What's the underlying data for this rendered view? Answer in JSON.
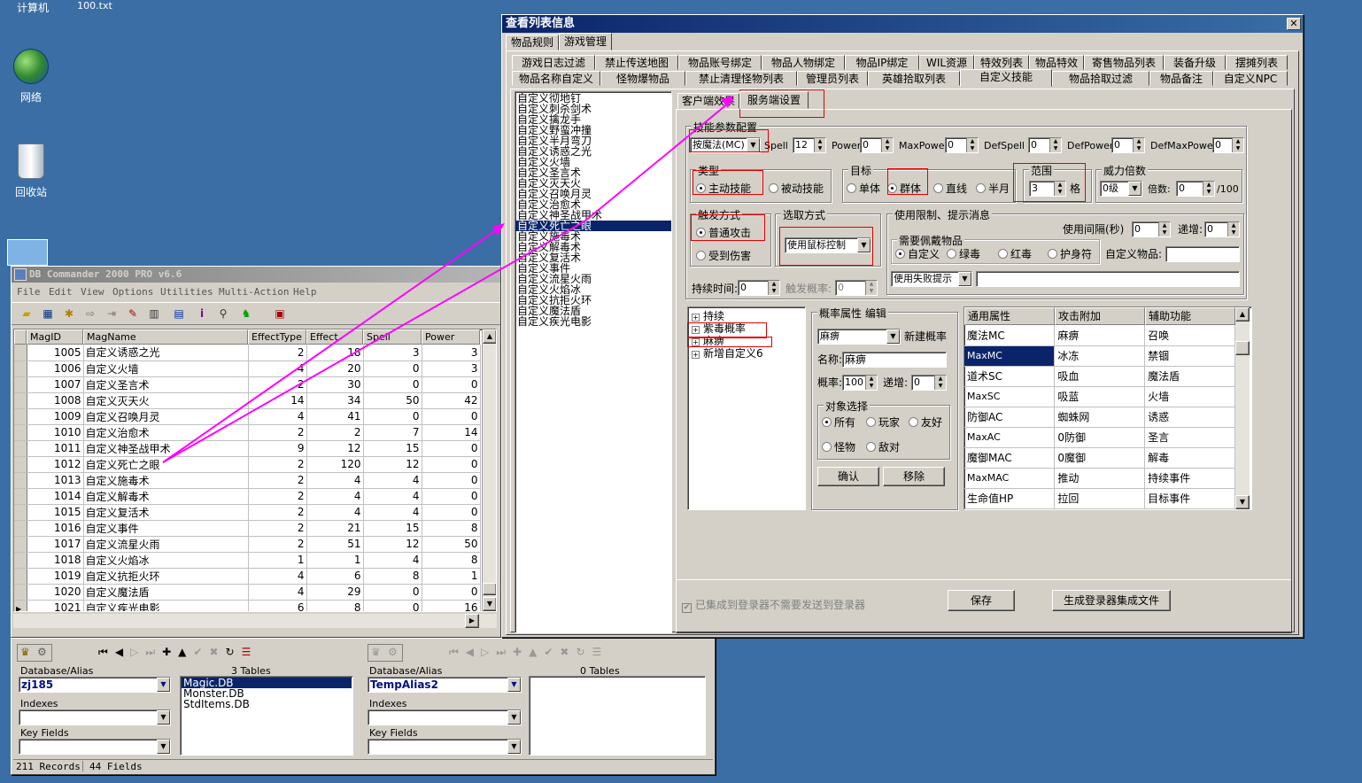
{
  "desktop": {
    "icons": [
      {
        "label": "计算机"
      },
      {
        "label": "100.txt"
      },
      {
        "label": "网络"
      },
      {
        "label": "回收站"
      }
    ]
  },
  "dbc": {
    "title": "DB Commander 2000 PRO v6.6",
    "menu": [
      "File",
      "Edit",
      "View",
      "Options",
      "Utilities",
      "Multi-Action",
      "Help"
    ],
    "columns": [
      "MagID",
      "MagName",
      "EffectType",
      "Effect",
      "Spell",
      "Power"
    ],
    "rows": [
      [
        "1005",
        "自定义诱惑之光",
        "2",
        "18",
        "3",
        "3"
      ],
      [
        "1006",
        "自定义火墙",
        "4",
        "20",
        "0",
        "3"
      ],
      [
        "1007",
        "自定义圣言术",
        "2",
        "30",
        "0",
        "0"
      ],
      [
        "1008",
        "自定义灭天火",
        "14",
        "34",
        "50",
        "42"
      ],
      [
        "1009",
        "自定义召唤月灵",
        "4",
        "41",
        "0",
        "0"
      ],
      [
        "1010",
        "自定义治愈术",
        "2",
        "2",
        "7",
        "14"
      ],
      [
        "1011",
        "自定义神圣战甲术",
        "9",
        "12",
        "15",
        "0"
      ],
      [
        "1012",
        "自定义死亡之眼",
        "2",
        "120",
        "12",
        "0"
      ],
      [
        "1013",
        "自定义施毒术",
        "2",
        "4",
        "4",
        "0"
      ],
      [
        "1014",
        "自定义解毒术",
        "2",
        "4",
        "4",
        "0"
      ],
      [
        "1015",
        "自定义复活术",
        "2",
        "4",
        "4",
        "0"
      ],
      [
        "1016",
        "自定义事件",
        "2",
        "21",
        "15",
        "8"
      ],
      [
        "1017",
        "自定义流星火雨",
        "2",
        "51",
        "12",
        "50"
      ],
      [
        "1018",
        "自定义火焰冰",
        "1",
        "1",
        "4",
        "8"
      ],
      [
        "1019",
        "自定义抗拒火环",
        "4",
        "6",
        "8",
        "1"
      ],
      [
        "1020",
        "自定义魔法盾",
        "4",
        "29",
        "0",
        "0"
      ],
      [
        "1021",
        "自定义疾光电影",
        "6",
        "8",
        "0",
        "16"
      ]
    ],
    "left_pane": {
      "db_label": "Database/Alias",
      "db_value": "zj185",
      "tables_label": "3 Tables",
      "tables": [
        "Magic.DB",
        "Monster.DB",
        "StdItems.DB"
      ],
      "indexes_label": "Indexes",
      "keyfields_label": "Key Fields"
    },
    "right_pane": {
      "db_label": "Database/Alias",
      "db_value": "TempAlias2",
      "tables_label": "0 Tables",
      "indexes_label": "Indexes",
      "keyfields_label": "Key Fields"
    },
    "status": {
      "records": "211 Records",
      "fields": "44 Fields"
    }
  },
  "dlg": {
    "title": "查看列表信息",
    "top_tabs": [
      "物品规则",
      "游戏管理"
    ],
    "tabs_row1": [
      "游戏日志过滤",
      "禁止传送地图",
      "物品账号绑定",
      "物品人物绑定",
      "物品IP绑定",
      "WIL资源",
      "特效列表",
      "物品特效",
      "寄售物品列表",
      "装备升级",
      "摆摊列表"
    ],
    "tabs_row2": [
      "物品名称自定义",
      "怪物爆物品",
      "禁止清理怪物列表",
      "管理员列表",
      "英雄拾取列表",
      "自定义技能",
      "物品拾取过滤",
      "物品备注",
      "自定义NPC"
    ],
    "skill_list": [
      "自定义彻地钉",
      "自定义刺杀剑术",
      "自定义擒龙手",
      "自定义野蛮冲撞",
      "自定义半月弯刀",
      "自定义诱惑之光",
      "自定义火墙",
      "自定义圣言术",
      "自定义灭天火",
      "自定义召唤月灵",
      "自定义治愈术",
      "自定义神圣战甲术",
      "自定义死亡之眼",
      "自定义施毒术",
      "自定义解毒术",
      "自定义复活术",
      "自定义事件",
      "自定义流星火雨",
      "自定义火焰冰",
      "自定义抗拒火环",
      "自定义魔法盾",
      "自定义疾光电影"
    ],
    "sub_tabs": [
      "客户端效果",
      "服务端设置"
    ],
    "skill_cfg": {
      "label": "技能参数配置",
      "mode_value": "按魔法(MC)",
      "spell_label": "Spell",
      "spell_value": "12",
      "power_label": "Power",
      "power_value": "0",
      "maxpower_label": "MaxPower",
      "maxpower_value": "0",
      "defspell_label": "DefSpell",
      "defspell_value": "0",
      "defpower_label": "DefPower",
      "defpower_value": "0",
      "defmaxpower_label": "DefMaxPower",
      "defmaxpower_value": "0"
    },
    "type": {
      "label": "类型",
      "opt1": "主动技能",
      "opt2": "被动技能"
    },
    "target": {
      "label": "目标",
      "opt1": "单体",
      "opt2": "群体",
      "opt3": "直线",
      "opt4": "半月"
    },
    "range": {
      "label": "范围",
      "value": "3",
      "unit": "格"
    },
    "power_mult": {
      "label": "威力倍数",
      "level_value": "0级",
      "mult_label": "倍数:",
      "mult_value": "0",
      "suffix": "/100"
    },
    "trigger": {
      "label": "触发方式",
      "opt1": "普通攻击",
      "opt2": "受到伤害"
    },
    "select": {
      "label": "选取方式",
      "value": "使用鼠标控制"
    },
    "limit": {
      "label": "使用限制、提示消息",
      "interval_label": "使用间隔(秒)",
      "interval_value": "0",
      "inc_label": "递增:",
      "inc_value": "0",
      "wear_label": "需要佩戴物品",
      "wear_opts": [
        "自定义",
        "绿毒",
        "红毒",
        "护身符"
      ],
      "custom_item_label": "自定义物品:",
      "fail_value": "使用失败提示"
    },
    "duration": {
      "label": "持续时间:",
      "value": "0",
      "prob_label": "触发概率:",
      "prob_value": "0"
    },
    "tree": [
      "持续",
      "紫毒概率",
      "麻痹",
      "新增自定义6"
    ],
    "prob": {
      "label": "概率属性 编辑",
      "combo_value": "麻痹",
      "new_label": "新建概率",
      "name_label": "名称:",
      "name_value": "麻痹",
      "rate_label": "概率:",
      "rate_value": "100",
      "inc_label": "递增:",
      "inc_value": "0",
      "obj_label": "对象选择",
      "obj_opts": [
        "所有",
        "玩家",
        "友好",
        "怪物",
        "敌对"
      ],
      "ok": "确认",
      "remove": "移除"
    },
    "attr_grid": {
      "headers": [
        "通用属性",
        "攻击附加",
        "辅助功能"
      ],
      "rows": [
        [
          "魔法MC",
          "麻痹",
          "召唤"
        ],
        [
          "MaxMC",
          "冰冻",
          "禁锢"
        ],
        [
          "道术SC",
          "吸血",
          "魔法盾"
        ],
        [
          "MaxSC",
          "吸蓝",
          "火墙"
        ],
        [
          "防御AC",
          "蜘蛛网",
          "诱惑"
        ],
        [
          "MaxAC",
          "0防御",
          "圣言"
        ],
        [
          "魔御MAC",
          "0魔御",
          "解毒"
        ],
        [
          "MaxMAC",
          "推动",
          "持续事件"
        ],
        [
          "生命值HP",
          "拉回",
          "目标事件"
        ]
      ]
    },
    "footer": {
      "check_label": "已集成到登录器不需要发送到登录器",
      "save": "保存",
      "generate": "生成登录器集成文件"
    }
  }
}
